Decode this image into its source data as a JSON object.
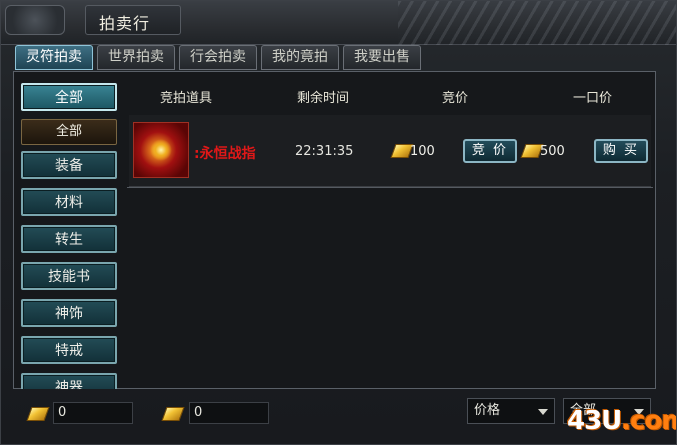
{
  "window": {
    "title": "拍卖行"
  },
  "tabs": [
    {
      "label": "灵符拍卖",
      "active": true
    },
    {
      "label": "世界拍卖",
      "active": false
    },
    {
      "label": "行会拍卖",
      "active": false
    },
    {
      "label": "我的竟拍",
      "active": false
    },
    {
      "label": "我要出售",
      "active": false
    }
  ],
  "sidebar": {
    "items": [
      {
        "label": "全部",
        "active": true
      },
      {
        "label": "全部",
        "sub": true
      },
      {
        "label": "装备"
      },
      {
        "label": "材料"
      },
      {
        "label": "转生"
      },
      {
        "label": "技能书"
      },
      {
        "label": "神饰"
      },
      {
        "label": "特戒"
      },
      {
        "label": "神器"
      }
    ]
  },
  "columns": {
    "item": "竞拍道具",
    "time": "剩余时间",
    "bid": "竞价",
    "buyout": "一口价"
  },
  "listings": [
    {
      "name": ":永恒战指",
      "time_left": "22:31:35",
      "bid_price": "100",
      "bid_button": "竞 价",
      "buyout_price": "500",
      "buy_button": "购 买"
    }
  ],
  "bottom": {
    "currency1_value": "0",
    "currency2_value": "0",
    "sort_select": "价格",
    "filter_select": "全部"
  },
  "watermark": {
    "text": "43U",
    "suffix": ".com"
  },
  "colors": {
    "item_name": "#e01818",
    "accent_teal": "#3a8594",
    "gold": "#f2c234"
  },
  "icons": {
    "item": "ring-item-icon",
    "gold": "gold-ingot-icon"
  }
}
